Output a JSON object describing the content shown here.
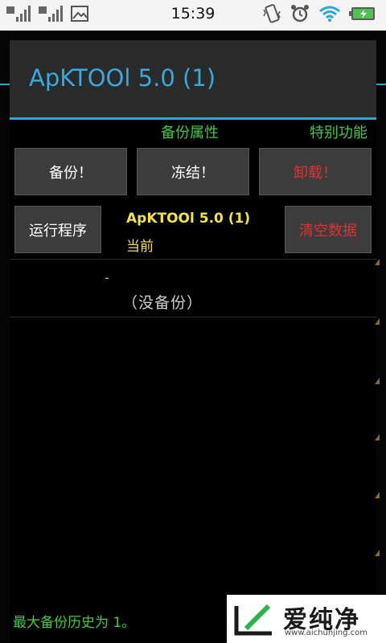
{
  "status_bar": {
    "time": "15:39",
    "left_icons": [
      "signal-icon",
      "signal-icon",
      "image-icon"
    ],
    "right_icons": [
      "vibrate-icon",
      "alarm-icon",
      "wifi-icon",
      "battery-icon"
    ]
  },
  "dialog": {
    "title": "ApKTOOl 5.0 (1)",
    "tabs": [
      "备份属性",
      "特别功能"
    ],
    "buttons": {
      "backup": "备份！",
      "freeze": "冻结！",
      "uninstall": "卸载！",
      "run": "运行程序",
      "clear_data": "清空数据"
    },
    "current_app": {
      "name": "ApKTOOl 5.0 (1)",
      "label": "当前"
    },
    "backup_entry": {
      "dash": "-",
      "empty_text": "（没备份）"
    },
    "footer": "最大备份历史为 1。"
  },
  "watermark": {
    "text": "爱纯净",
    "url": "www.aichunjing.com"
  },
  "colors": {
    "title_blue": "#37a9dc",
    "tab_green": "#3dcc3d",
    "danger_red": "#e03030",
    "highlight_yellow": "#f2e24a"
  }
}
